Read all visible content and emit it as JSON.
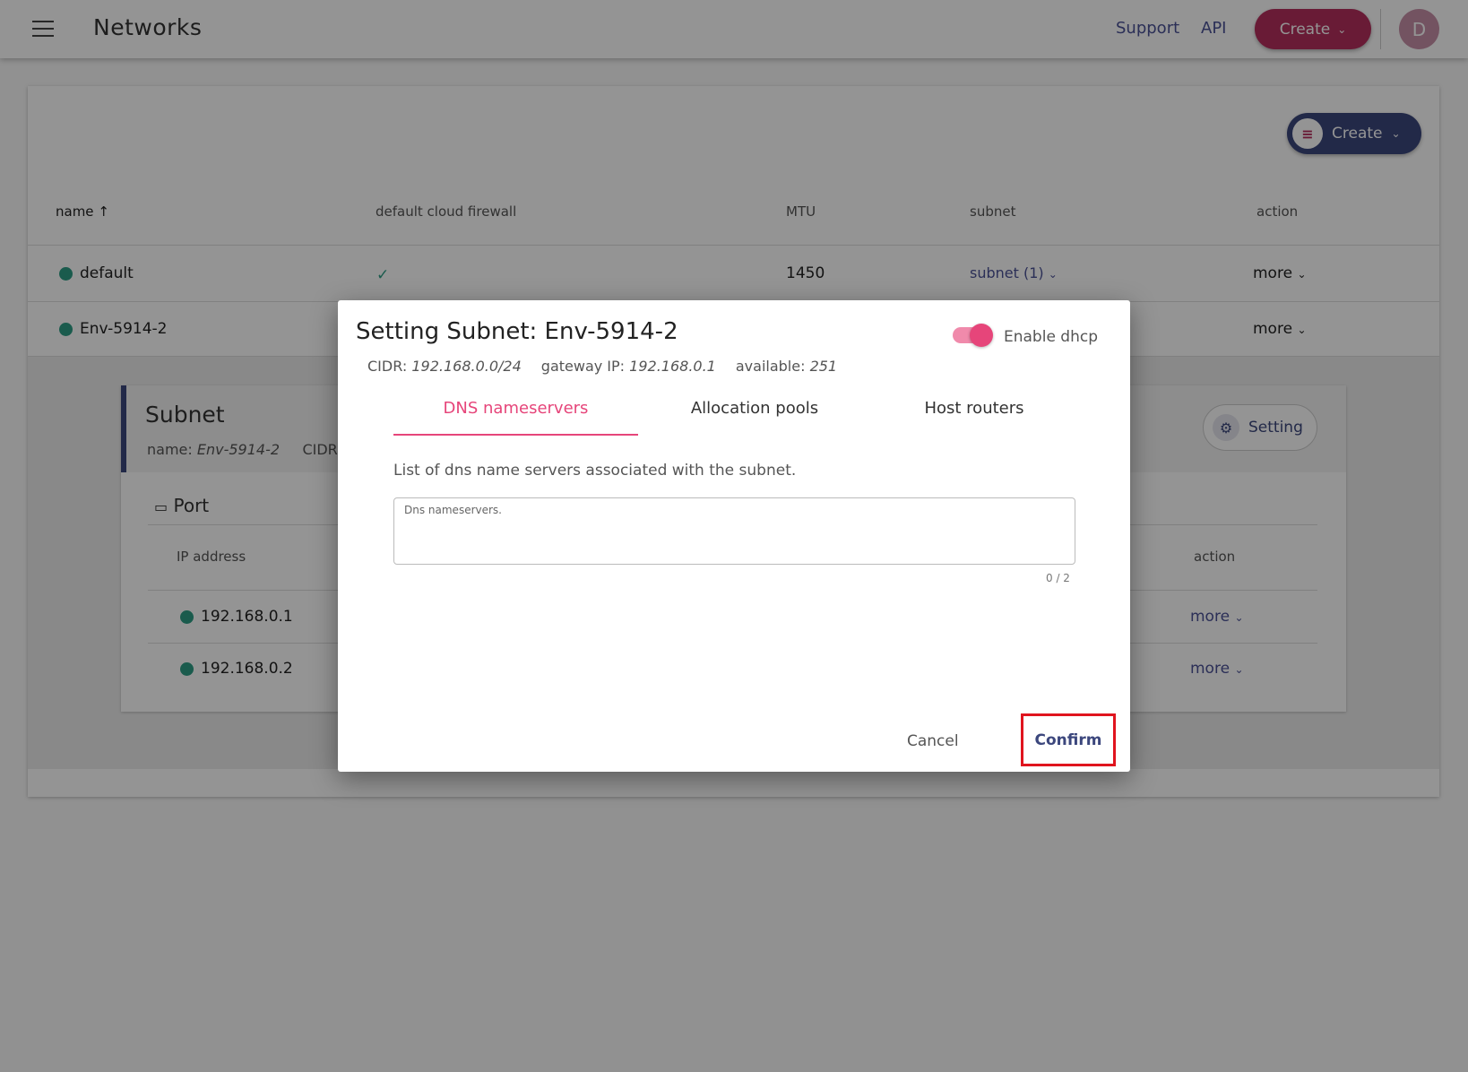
{
  "header": {
    "title": "Networks",
    "support_label": "Support",
    "api_label": "API",
    "create_label": "Create",
    "avatar_initial": "D"
  },
  "toolbar": {
    "create_label": "Create"
  },
  "table": {
    "columns": [
      "name",
      "default cloud firewall",
      "MTU",
      "subnet",
      "action"
    ],
    "sort_indicator": "↑",
    "rows": [
      {
        "name": "default",
        "firewall": "✓",
        "mtu": "1450",
        "subnet": "subnet (1)",
        "action": "more"
      },
      {
        "name": "Env-5914-2",
        "action": "more"
      }
    ]
  },
  "subnet_panel": {
    "title": "Subnet",
    "name_label": "name:",
    "name_value": "Env-5914-2",
    "cidr_label": "CIDR:",
    "setting_label": "Setting",
    "port": {
      "title": "Port",
      "columns": [
        "IP address",
        "action"
      ],
      "rows": [
        {
          "ip": "192.168.0.1",
          "action": "more"
        },
        {
          "ip": "192.168.0.2",
          "action": "more"
        }
      ]
    }
  },
  "modal": {
    "title": "Setting Subnet: Env-5914-2",
    "dhcp_label": "Enable dhcp",
    "dhcp_enabled": true,
    "cidr_label": "CIDR:",
    "cidr_value": "192.168.0.0/24",
    "gateway_label": "gateway IP:",
    "gateway_value": "192.168.0.1",
    "available_label": "available:",
    "available_value": "251",
    "tabs": [
      "DNS nameservers",
      "Allocation pools",
      "Host routers"
    ],
    "active_tab": "DNS nameservers",
    "description": "List of dns name servers associated with the subnet.",
    "textarea_placeholder": "Dns nameservers.",
    "counter": "0 / 2",
    "cancel_label": "Cancel",
    "confirm_label": "Confirm"
  },
  "colors": {
    "accent_pink": "#e6457a",
    "primary_navy": "#3c477d",
    "status_green": "#2e9e85",
    "highlight_red": "#e0141e"
  }
}
